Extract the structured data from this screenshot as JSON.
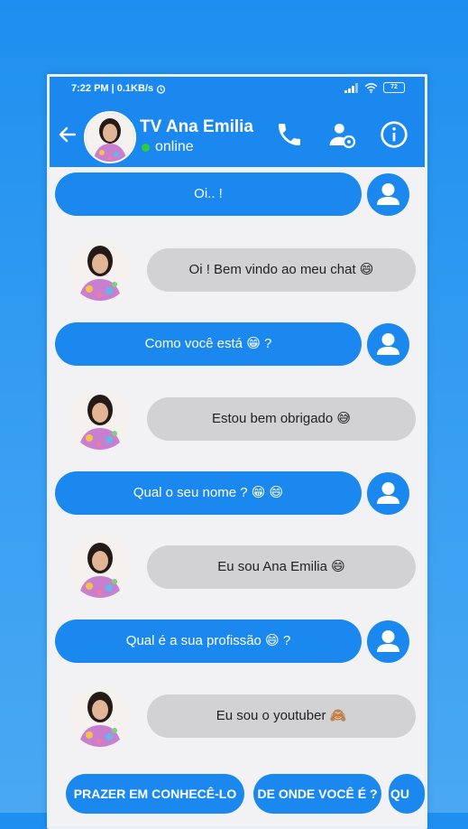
{
  "status_bar": {
    "time_net": "7:22 PM | 0.1KB/s",
    "battery": "72"
  },
  "header": {
    "contact_name": "TV Ana Emilia",
    "status": "online"
  },
  "messages": [
    {
      "from": "user",
      "text": "Oi.. !"
    },
    {
      "from": "contact",
      "text": "Oi ! Bem vindo ao meu chat 😄"
    },
    {
      "from": "user",
      "text": "Como você está 😁 ?"
    },
    {
      "from": "contact",
      "text": "Estou bem obrigado 😅"
    },
    {
      "from": "user",
      "text": "Qual o seu nome ? 😁 😄"
    },
    {
      "from": "contact",
      "text": "Eu sou Ana Emilia 😄"
    },
    {
      "from": "user",
      "text": "Qual é a sua profissão 😄 ?"
    },
    {
      "from": "contact",
      "text": "Eu sou o youtuber 🙈"
    }
  ],
  "suggestions": [
    "PRAZER EM CONHECÊ-LO",
    "DE ONDE VOCÊ É ?",
    "QU"
  ],
  "colors": {
    "accent": "#1a88ee",
    "incoming_bubble": "#d2d2d4",
    "online": "#2ecc40"
  }
}
